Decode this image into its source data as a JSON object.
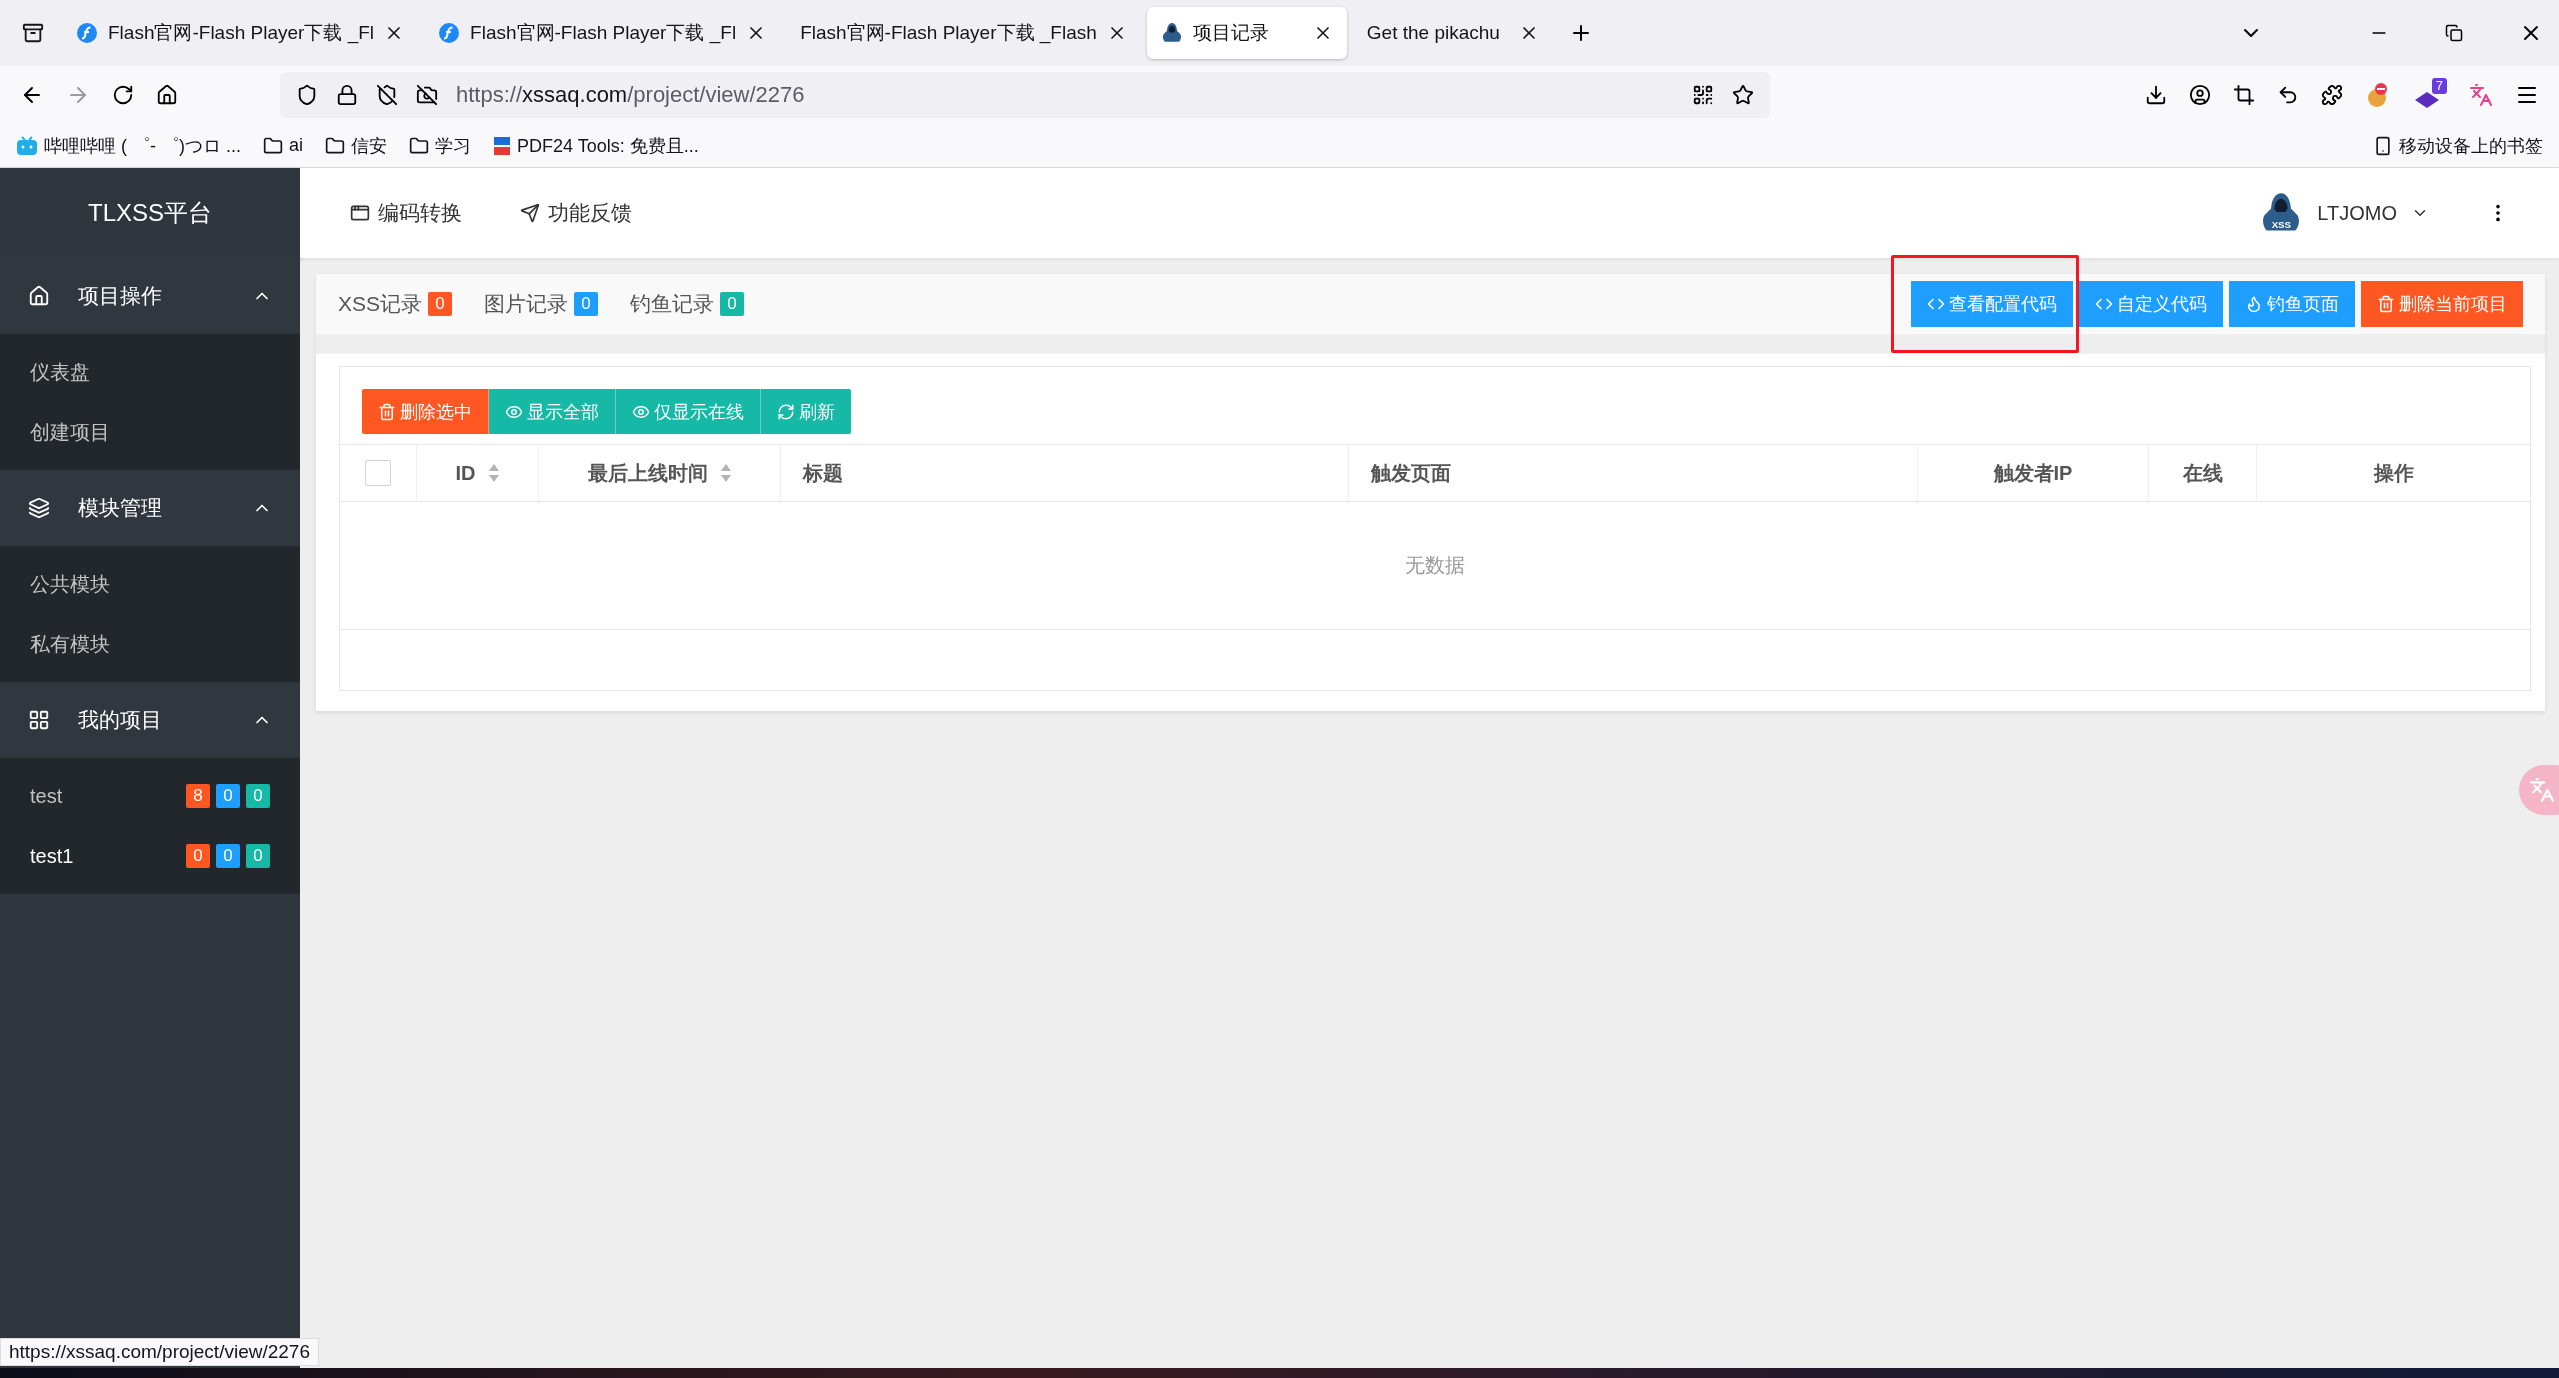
{
  "browser": {
    "tabs": [
      {
        "title": "Flash官网-Flash Player下载 _Fl",
        "kind": "flash",
        "selected": false
      },
      {
        "title": "Flash官网-Flash Player下载 _Fl",
        "kind": "flash",
        "selected": false
      },
      {
        "title": "Flash官网-Flash Player下载 _Flash",
        "kind": "plain",
        "selected": false
      },
      {
        "title": "项目记录",
        "kind": "hacker",
        "selected": true
      },
      {
        "title": "Get the pikachu",
        "kind": "plain",
        "selected": false
      }
    ],
    "url_host": "xssaq.com",
    "url_prefix": "https://",
    "url_path": "/project/view/2276",
    "extension_badge": "7",
    "bookmarks": [
      {
        "label": "哔哩哔哩 ( ゜- ゜)つロ ...",
        "kind": "bilibili"
      },
      {
        "label": "ai",
        "kind": "folder"
      },
      {
        "label": "信安",
        "kind": "folder"
      },
      {
        "label": "学习",
        "kind": "folder"
      },
      {
        "label": "PDF24 Tools: 免费且...",
        "kind": "pdf"
      }
    ],
    "mobile_bookmarks": "移动设备上的书签"
  },
  "sidebar": {
    "brand": "TLXSS平台",
    "sections": [
      {
        "title": "项目操作",
        "kind": "home",
        "expanded": true,
        "items": [
          {
            "label": "仪表盘",
            "selected": false
          },
          {
            "label": "创建项目",
            "selected": false
          }
        ]
      },
      {
        "title": "模块管理",
        "kind": "layers",
        "expanded": true,
        "items": [
          {
            "label": "公共模块",
            "selected": false
          },
          {
            "label": "私有模块",
            "selected": false
          }
        ]
      },
      {
        "title": "我的项目",
        "kind": "apps",
        "expanded": true,
        "items": [
          {
            "label": "test",
            "selected": false,
            "badges": [
              {
                "text": "8",
                "color": "#ff5722"
              },
              {
                "text": "0",
                "color": "#1e9fff"
              },
              {
                "text": "0",
                "color": "#16b8a6"
              }
            ]
          },
          {
            "label": "test1",
            "selected": true,
            "badges": [
              {
                "text": "0",
                "color": "#ff5722"
              },
              {
                "text": "0",
                "color": "#1e9fff"
              },
              {
                "text": "0",
                "color": "#16b8a6"
              }
            ]
          }
        ]
      }
    ]
  },
  "topnav": [
    {
      "label": "编码转换",
      "kind": "window"
    },
    {
      "label": "功能反馈",
      "kind": "send"
    }
  ],
  "user": {
    "name": "LTJOMO",
    "avatar_text": "XSS"
  },
  "record_tabs": [
    {
      "label": "XSS记录",
      "count": "0",
      "color": "#ff5722"
    },
    {
      "label": "图片记录",
      "count": "0",
      "color": "#1e9fff"
    },
    {
      "label": "钓鱼记录",
      "count": "0",
      "color": "#16b8a6"
    }
  ],
  "action_buttons": [
    {
      "label": "查看配置代码",
      "kind": "code",
      "color": "#1e9fff",
      "highlighted": true
    },
    {
      "label": "自定义代码",
      "kind": "code",
      "color": "#1e9fff",
      "highlighted": false
    },
    {
      "label": "钓鱼页面",
      "kind": "fire",
      "color": "#1e9fff",
      "highlighted": false
    },
    {
      "label": "删除当前项目",
      "kind": "trash",
      "color": "#ff5722",
      "highlighted": false
    }
  ],
  "toolbar_buttons": [
    {
      "label": "删除选中",
      "kind": "trash",
      "color": "#ff5722"
    },
    {
      "label": "显示全部",
      "kind": "eye",
      "color": "#16b8a6"
    },
    {
      "label": "仅显示在线",
      "kind": "eye",
      "color": "#16b8a6"
    },
    {
      "label": "刷新",
      "kind": "refresh",
      "color": "#16b8a6"
    }
  ],
  "table": {
    "select_all_checked": false,
    "columns": [
      {
        "label": "ID",
        "sortable": true
      },
      {
        "label": "最后上线时间",
        "sortable": true
      },
      {
        "label": "标题",
        "sortable": false
      },
      {
        "label": "触发页面",
        "sortable": false
      },
      {
        "label": "触发者IP",
        "sortable": false
      },
      {
        "label": "在线",
        "sortable": false
      },
      {
        "label": "操作",
        "sortable": false
      }
    ],
    "empty_text": "无数据"
  },
  "status_url": "https://xssaq.com/project/view/2276"
}
